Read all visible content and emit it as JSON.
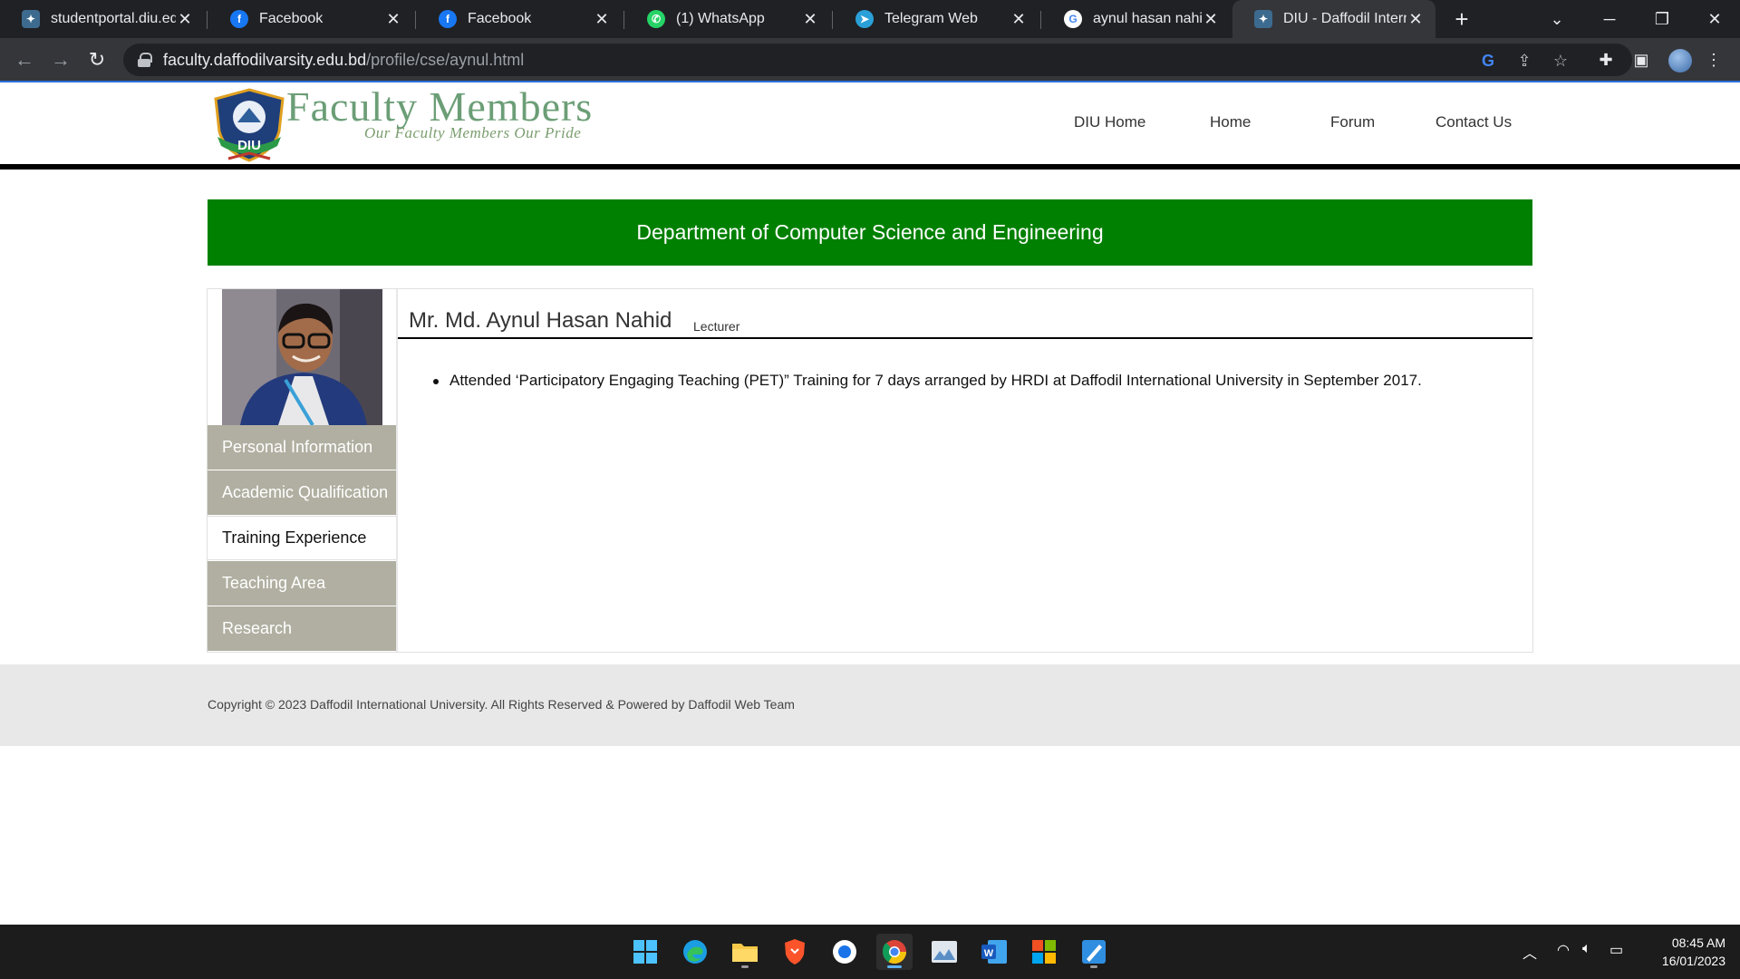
{
  "browser": {
    "tabs": [
      {
        "title": "studentportal.diu.edu",
        "icon": "diu-favicon"
      },
      {
        "title": "Facebook",
        "icon": "facebook-favicon"
      },
      {
        "title": "Facebook",
        "icon": "facebook-favicon"
      },
      {
        "title": "(1) WhatsApp",
        "icon": "whatsapp-favicon"
      },
      {
        "title": "Telegram Web",
        "icon": "telegram-favicon"
      },
      {
        "title": "aynul hasan nahid diu",
        "icon": "google-favicon"
      },
      {
        "title": "DIU - Daffodil Interna",
        "icon": "diu-favicon",
        "active": true
      }
    ],
    "new_tab_label": "+",
    "url_host": "faculty.daffodilvarsity.edu.bd",
    "url_path": "/profile/cse/aynul.html",
    "colors": {
      "tabbar": "#202124",
      "toolbar": "#35363a",
      "accent": "#2d6fd8"
    }
  },
  "site": {
    "logo_title": "Faculty Members",
    "logo_tagline": "Our Faculty Members Our Pride",
    "logo_badge_text": "DIU",
    "nav": [
      "DIU Home",
      "Home",
      "Forum",
      "Contact Us"
    ],
    "department_banner": "Department of Computer Science and Engineering",
    "colors": {
      "banner": "#008000",
      "sidebar": "#b1afa1"
    }
  },
  "profile": {
    "name": "Mr. Md. Aynul Hasan Nahid",
    "title": "Lecturer",
    "sidebar": [
      {
        "label": "Personal Information"
      },
      {
        "label": "Academic Qualification"
      },
      {
        "label": "Training Experience",
        "active": true
      },
      {
        "label": "Teaching Area"
      },
      {
        "label": "Research"
      }
    ],
    "training_items": [
      "Attended ‘Participatory Engaging Teaching (PET)” Training for 7 days arranged by HRDI at Daffodil International University in September 2017."
    ]
  },
  "footer": {
    "copyright": "Copyright © 2023 Daffodil International University. All Rights Reserved & Powered by Daffodil Web Team"
  },
  "taskbar": {
    "apps": [
      "windows-start-icon",
      "edge-icon",
      "file-explorer-icon",
      "brave-icon",
      "app-icon",
      "chrome-icon",
      "photos-icon",
      "word-icon",
      "store-icon",
      "paint-icon"
    ],
    "time": "08:45 AM",
    "date": "16/01/2023"
  }
}
